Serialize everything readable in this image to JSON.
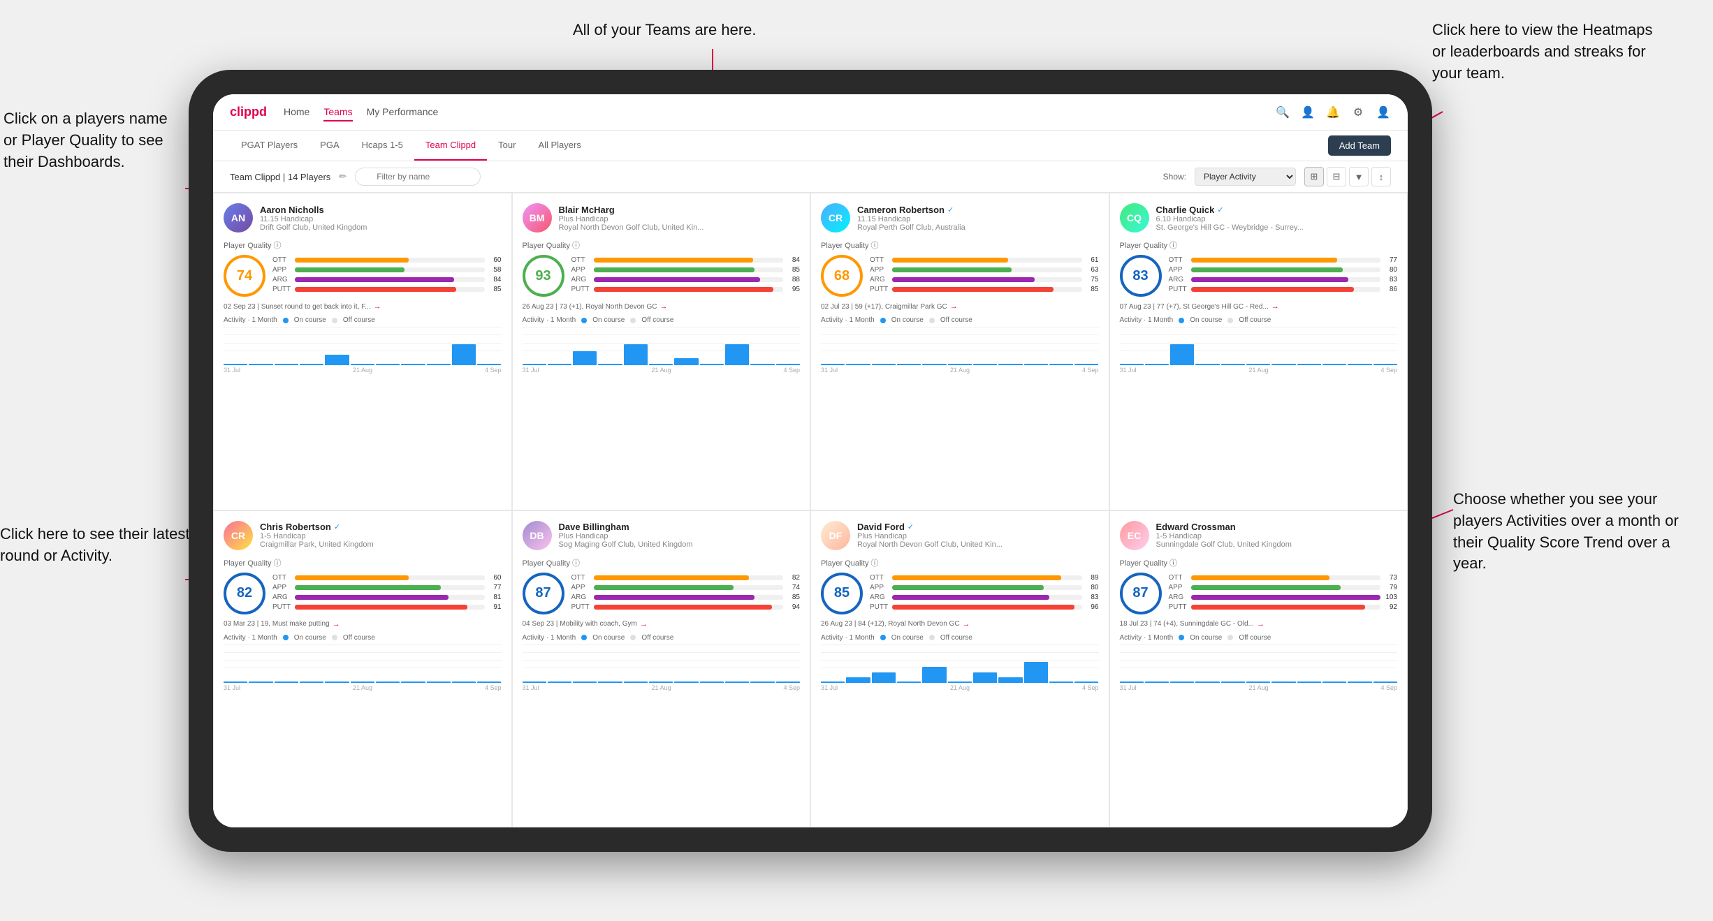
{
  "annotations": {
    "top_left": "Click on a players name\nor Player Quality to see\ntheir Dashboards.",
    "bottom_left": "Click here to see their latest\nround or Activity.",
    "top_center": "All of your Teams are here.",
    "top_right": "Click here to view the\nHeatmaps or leaderboards\nand streaks for your team.",
    "bottom_right": "Choose whether you see\nyour players Activities over\na month or their Quality\nScore Trend over a year."
  },
  "navbar": {
    "brand": "clippd",
    "links": [
      "Home",
      "Teams",
      "My Performance"
    ],
    "active": "Teams"
  },
  "subnav": {
    "tabs": [
      "PGAT Players",
      "PGA",
      "Hcaps 1-5",
      "Team Clippd",
      "Tour",
      "All Players"
    ],
    "active": "Team Clippd",
    "add_button": "Add Team"
  },
  "toolbar": {
    "team_label": "Team Clippd | 14 Players",
    "filter_placeholder": "Filter by name",
    "show_label": "Show:",
    "show_value": "Player Activity",
    "view_modes": [
      "grid-2x2",
      "grid-3x3",
      "filter",
      "sort"
    ]
  },
  "players": [
    {
      "id": 1,
      "name": "Aaron Nicholls",
      "handicap": "11.15 Handicap",
      "club": "Drift Golf Club, United Kingdom",
      "quality": 74,
      "quality_color": "blue",
      "avatar_class": "av-1",
      "initials": "AN",
      "verified": false,
      "stats": {
        "OTT": 60,
        "APP": 58,
        "ARG": 84,
        "PUTT": 85
      },
      "latest": "02 Sep 23 | Sunset round to get back into it, F...",
      "activity_bars": [
        0,
        0,
        0,
        0,
        1,
        0,
        0,
        0,
        0,
        2,
        0
      ],
      "chart_labels": [
        "31 Jul",
        "21 Aug",
        "4 Sep"
      ]
    },
    {
      "id": 2,
      "name": "Blair McHarg",
      "handicap": "Plus Handicap",
      "club": "Royal North Devon Golf Club, United Kin...",
      "quality": 93,
      "quality_color": "green",
      "avatar_class": "av-2",
      "initials": "BM",
      "verified": false,
      "stats": {
        "OTT": 84,
        "APP": 85,
        "ARG": 88,
        "PUTT": 95
      },
      "latest": "26 Aug 23 | 73 (+1), Royal North Devon GC",
      "activity_bars": [
        0,
        0,
        2,
        0,
        3,
        0,
        1,
        0,
        3,
        0,
        0
      ],
      "chart_labels": [
        "31 Jul",
        "21 Aug",
        "4 Sep"
      ]
    },
    {
      "id": 3,
      "name": "Cameron Robertson",
      "handicap": "11.15 Handicap",
      "club": "Royal Perth Golf Club, Australia",
      "quality": 68,
      "quality_color": "orange",
      "avatar_class": "av-3",
      "initials": "CR",
      "verified": true,
      "stats": {
        "OTT": 61,
        "APP": 63,
        "ARG": 75,
        "PUTT": 85
      },
      "latest": "02 Jul 23 | 59 (+17), Craigmillar Park GC",
      "activity_bars": [
        0,
        0,
        0,
        0,
        0,
        0,
        0,
        0,
        0,
        0,
        0
      ],
      "chart_labels": [
        "31 Jul",
        "21 Aug",
        "4 Sep"
      ]
    },
    {
      "id": 4,
      "name": "Charlie Quick",
      "handicap": "6.10 Handicap",
      "club": "St. George's Hill GC - Weybridge - Surrey...",
      "quality": 83,
      "quality_color": "blue",
      "avatar_class": "av-4",
      "initials": "CQ",
      "verified": true,
      "stats": {
        "OTT": 77,
        "APP": 80,
        "ARG": 83,
        "PUTT": 86
      },
      "latest": "07 Aug 23 | 77 (+7), St George's Hill GC - Red...",
      "activity_bars": [
        0,
        0,
        1,
        0,
        0,
        0,
        0,
        0,
        0,
        0,
        0
      ],
      "chart_labels": [
        "31 Jul",
        "21 Aug",
        "4 Sep"
      ]
    },
    {
      "id": 5,
      "name": "Chris Robertson",
      "handicap": "1-5 Handicap",
      "club": "Craigmillar Park, United Kingdom",
      "quality": 82,
      "quality_color": "blue",
      "avatar_class": "av-5",
      "initials": "CR",
      "verified": true,
      "stats": {
        "OTT": 60,
        "APP": 77,
        "ARG": 81,
        "PUTT": 91
      },
      "latest": "03 Mar 23 | 19, Must make putting",
      "activity_bars": [
        0,
        0,
        0,
        0,
        0,
        0,
        0,
        0,
        0,
        0,
        0
      ],
      "chart_labels": [
        "31 Jul",
        "21 Aug",
        "4 Sep"
      ]
    },
    {
      "id": 6,
      "name": "Dave Billingham",
      "handicap": "Plus Handicap",
      "club": "Sog Maging Golf Club, United Kingdom",
      "quality": 87,
      "quality_color": "green",
      "avatar_class": "av-6",
      "initials": "DB",
      "verified": false,
      "stats": {
        "OTT": 82,
        "APP": 74,
        "ARG": 85,
        "PUTT": 94
      },
      "latest": "04 Sep 23 | Mobility with coach, Gym",
      "activity_bars": [
        0,
        0,
        0,
        0,
        0,
        0,
        0,
        0,
        0,
        0,
        0
      ],
      "chart_labels": [
        "31 Jul",
        "21 Aug",
        "4 Sep"
      ]
    },
    {
      "id": 7,
      "name": "David Ford",
      "handicap": "Plus Handicap",
      "club": "Royal North Devon Golf Club, United Kin...",
      "quality": 85,
      "quality_color": "green",
      "avatar_class": "av-7",
      "initials": "DF",
      "verified": true,
      "stats": {
        "OTT": 89,
        "APP": 80,
        "ARG": 83,
        "PUTT": 96
      },
      "latest": "26 Aug 23 | 84 (+12), Royal North Devon GC",
      "activity_bars": [
        0,
        1,
        2,
        0,
        3,
        0,
        2,
        1,
        4,
        0,
        0
      ],
      "chart_labels": [
        "31 Jul",
        "21 Aug",
        "4 Sep"
      ]
    },
    {
      "id": 8,
      "name": "Edward Crossman",
      "handicap": "1-5 Handicap",
      "club": "Sunningdale Golf Club, United Kingdom",
      "quality": 87,
      "quality_color": "green",
      "avatar_class": "av-8",
      "initials": "EC",
      "verified": false,
      "stats": {
        "OTT": 73,
        "APP": 79,
        "ARG": 103,
        "PUTT": 92
      },
      "latest": "18 Jul 23 | 74 (+4), Sunningdale GC - Old...",
      "activity_bars": [
        0,
        0,
        0,
        0,
        0,
        0,
        0,
        0,
        0,
        0,
        0
      ],
      "chart_labels": [
        "31 Jul",
        "21 Aug",
        "4 Sep"
      ]
    }
  ],
  "activity_legend": {
    "title": "Activity · 1 Month",
    "on_course": "On course",
    "off_course": "Off course"
  }
}
